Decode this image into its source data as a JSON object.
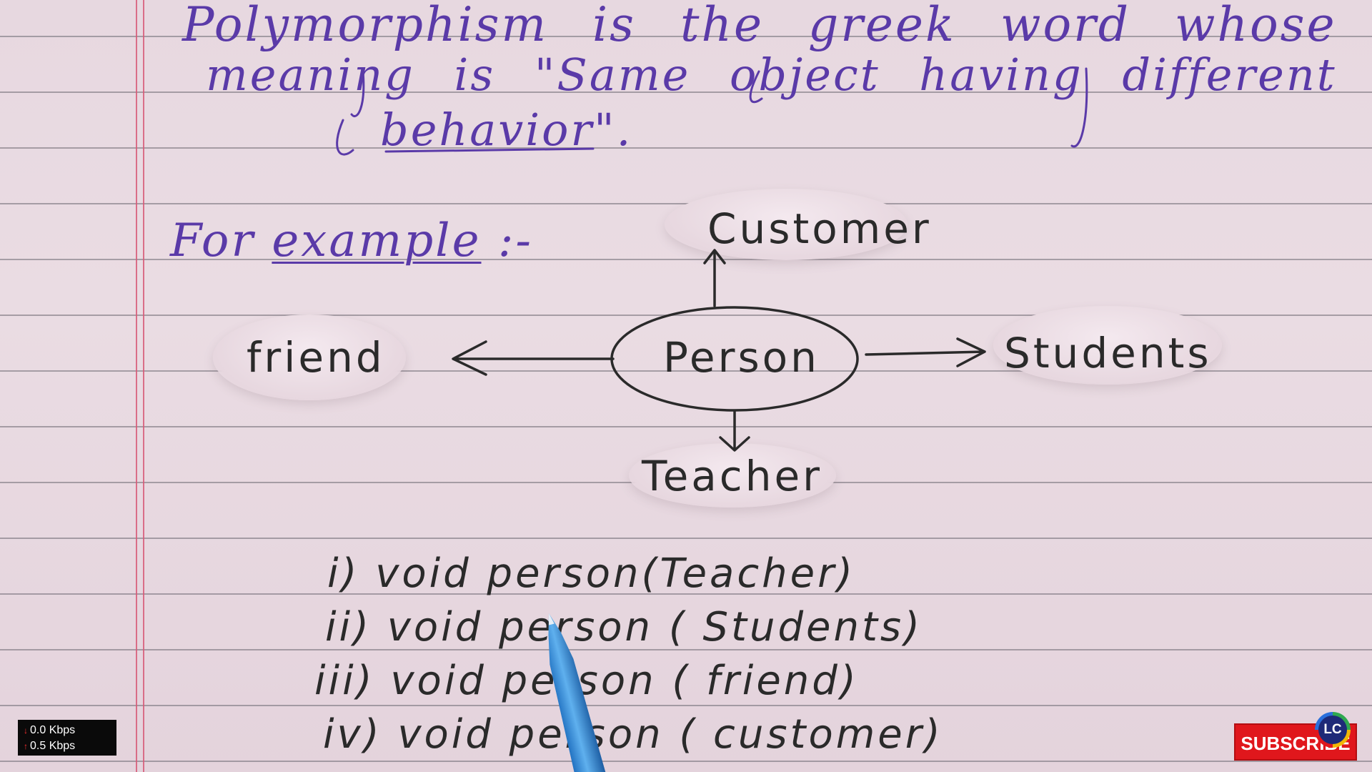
{
  "note": {
    "line1": "Polymorphism is the greek word whose",
    "line2": "meaning is \"Same object having different",
    "line3": "behavior\".",
    "for_example_prefix": "For",
    "for_example_word": "example",
    "for_example_suffix": ":-"
  },
  "diagram": {
    "center": "Person",
    "top": "Customer",
    "left": "friend",
    "right": "Students",
    "bottom": "Teacher"
  },
  "code_lines": [
    "i) void person(Teacher)",
    "ii) void person ( Students)",
    "iii) void person ( friend)",
    "iv) void person ( customer)"
  ],
  "overlay": {
    "download_rate": "0.0 Kbps",
    "upload_rate": "0.5 Kbps",
    "subscribe_label": "SUBSCRIBE",
    "logo_text": "LC"
  },
  "colors": {
    "paper": "#e9dae2",
    "ruled_line": "#6d6a73",
    "margin_line": "#d75a78",
    "purple_ink": "#5a3aa8",
    "black_ink": "#2a2a2a",
    "subscribe_red": "#e0171c"
  }
}
